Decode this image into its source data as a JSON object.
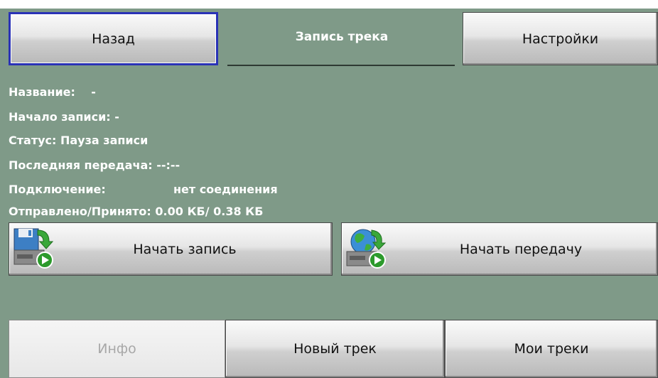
{
  "header": {
    "back_label": "Назад",
    "title": "Запись трека",
    "settings_label": "Настройки"
  },
  "info": {
    "name_label": "Название:",
    "name_value": "-",
    "start_label": "Начало записи:",
    "start_value": "-",
    "status_label": "Статус:",
    "status_value": "Пауза записи",
    "last_label": "Последняя передача:",
    "last_value": "--:--",
    "conn_label": "Подключение:",
    "conn_value": "нет соединения",
    "sent_label": "Отправлено/Принято:",
    "sent_value": "0.00 КБ/ 0.38 КБ"
  },
  "actions": {
    "start_record": "Начать запись",
    "start_record_icon": "floppy-record-icon",
    "start_transfer": "Начать передачу",
    "start_transfer_icon": "globe-transfer-icon"
  },
  "footer": {
    "info_label": "Инфо",
    "new_track_label": "Новый трек",
    "my_tracks_label": "Мои треки"
  },
  "colors": {
    "background": "#7f9a88",
    "selected_border": "#2a32b6",
    "text_light": "#ffffff"
  }
}
